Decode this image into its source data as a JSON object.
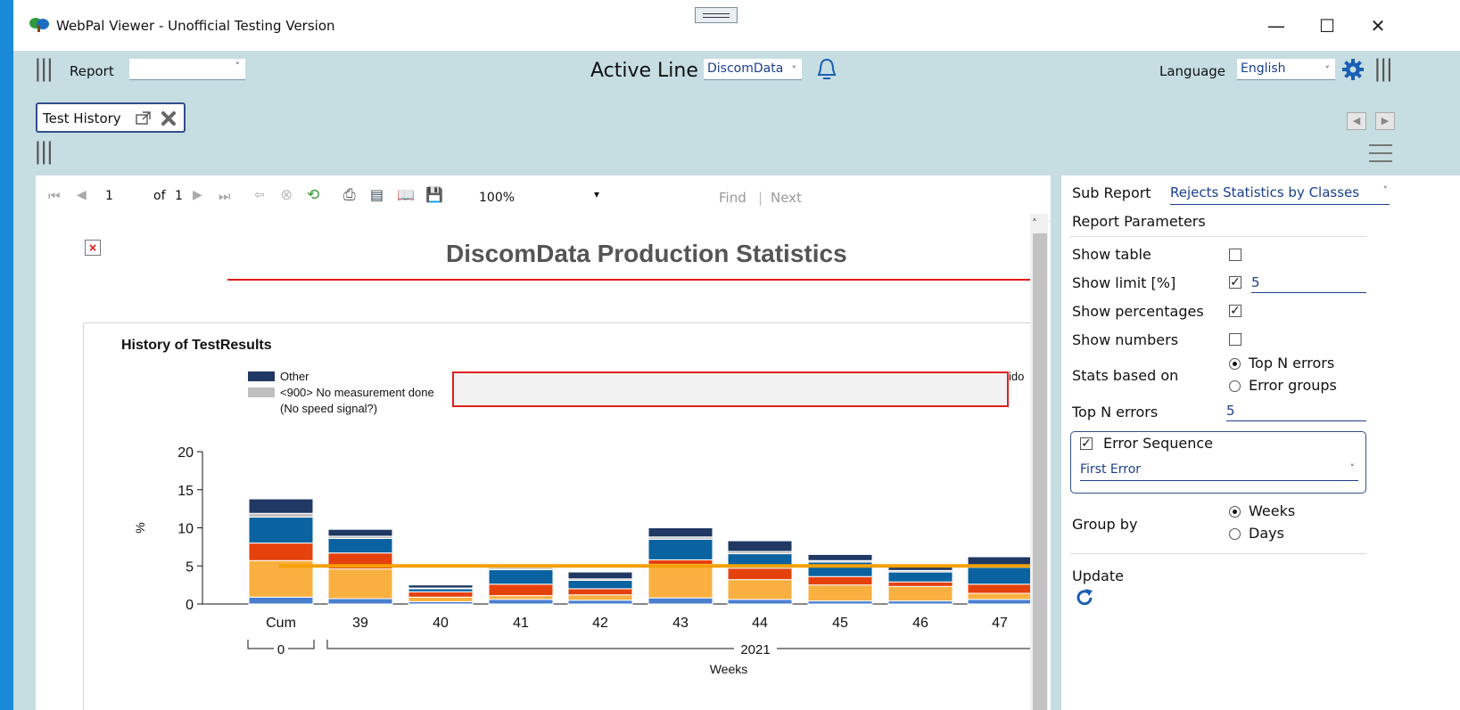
{
  "window": {
    "title": "WebPal Viewer - Unofficial Testing Version",
    "min": "—",
    "max": "☐",
    "close": "✕"
  },
  "toolbar": {
    "report_label": "Report",
    "report_value": "",
    "active_line_label": "Active Line",
    "active_line_value": "DiscomData",
    "language_label": "Language",
    "language_value": "English"
  },
  "tab": {
    "label": "Test History"
  },
  "viewer": {
    "page_input": "1",
    "page_of": "of",
    "page_total": "1",
    "zoom": "100%",
    "find_label": "Find",
    "next_label": "Next"
  },
  "report": {
    "title": "DiscomData Production Statistics",
    "chart_title": "History of TestResults",
    "legend": [
      {
        "label": "Other",
        "color": "#1f3864"
      },
      {
        "label": "<900> No measurement done",
        "color": "#bfbfbf"
      },
      {
        "label": "(No speed signal?)",
        "color": ""
      }
    ],
    "legend_clip": "ido"
  },
  "chart_data": {
    "type": "bar",
    "stacked": true,
    "title": "History of TestResults",
    "xlabel": "Weeks",
    "ylabel": "%",
    "ylim": [
      0,
      20
    ],
    "yticks": [
      0,
      5,
      10,
      15,
      20
    ],
    "categories": [
      "Cum",
      "39",
      "40",
      "41",
      "42",
      "43",
      "44",
      "45",
      "46",
      "47"
    ],
    "groups": [
      {
        "label": "0",
        "categories": [
          "Cum"
        ]
      },
      {
        "label": "2021",
        "categories": [
          "39",
          "40",
          "41",
          "42",
          "43",
          "44",
          "45",
          "46",
          "47"
        ]
      }
    ],
    "series": [
      {
        "color": "#4a7fd0",
        "values": [
          0.9,
          0.7,
          0.3,
          0.6,
          0.5,
          0.8,
          0.6,
          0.4,
          0.4,
          0.6
        ]
      },
      {
        "color": "#f9b040",
        "values": [
          4.8,
          3.9,
          0.6,
          0.5,
          0.7,
          4.4,
          2.6,
          2.1,
          1.9,
          0.8
        ]
      },
      {
        "color": "#e5410c",
        "values": [
          2.3,
          2.1,
          0.7,
          1.5,
          0.8,
          0.6,
          1.5,
          1.1,
          0.6,
          1.2
        ]
      },
      {
        "color": "#0a62a0",
        "values": [
          3.4,
          1.9,
          0.4,
          1.9,
          1.1,
          2.7,
          1.9,
          1.9,
          1.3,
          2.2
        ]
      },
      {
        "color": "#bfbfbf",
        "values": [
          0.5,
          0.3,
          0.1,
          0.2,
          0.2,
          0.3,
          0.3,
          0.2,
          0.2,
          0.3
        ]
      },
      {
        "name": "Other",
        "color": "#1f3864",
        "values": [
          1.9,
          0.9,
          0.4,
          0.4,
          0.9,
          1.2,
          1.4,
          0.8,
          0.5,
          1.1
        ]
      }
    ],
    "limit": {
      "value": 5,
      "color": "#f5a000"
    }
  },
  "panel": {
    "sub_report_label": "Sub Report",
    "sub_report_value": "Rejects Statistics by Classes",
    "params_heading": "Report Parameters",
    "show_table": "Show table",
    "show_limit": "Show limit [%]",
    "show_limit_value": "5",
    "show_percentages": "Show percentages",
    "show_numbers": "Show numbers",
    "stats_based_on": "Stats based on",
    "stats_opt1": "Top N errors",
    "stats_opt2": "Error groups",
    "top_n_label": "Top N errors",
    "top_n_value": "5",
    "error_sequence": "Error Sequence",
    "error_sequence_value": "First Error",
    "group_by": "Group by",
    "group_opt1": "Weeks",
    "group_opt2": "Days",
    "update": "Update"
  }
}
